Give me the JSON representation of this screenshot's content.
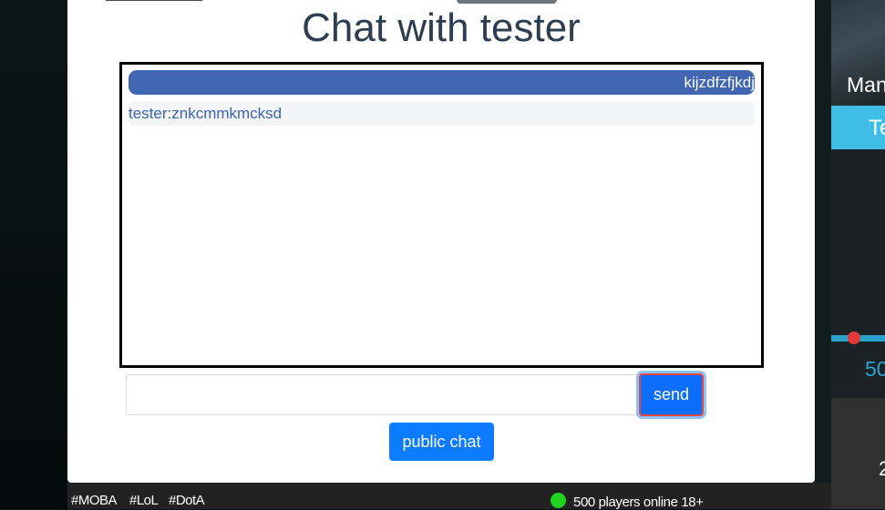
{
  "chat": {
    "title": "Chat with tester",
    "messages": [
      {
        "sender": "self",
        "text": "kijzdfzfjkdj"
      },
      {
        "sender": "other",
        "text": "tester:znkcmmkmcksd"
      }
    ],
    "input_value": "",
    "input_placeholder": "",
    "send_label": "send",
    "public_chat_label": "public chat"
  },
  "footer": {
    "tags": [
      "#MOBA",
      "#LoL",
      "#DotA"
    ],
    "players_online": "500 players online",
    "age_rating": "18+",
    "status_color": "#1fd31f"
  },
  "right_panel": {
    "name_partial": "Man",
    "tab_partial": "Te",
    "value_partial": "50",
    "card_partial": "2"
  },
  "colors": {
    "accent_blue": "#0d6efd",
    "own_message_bg": "#4267b2",
    "title_color": "#2c3e50",
    "right_tab": "#3fbde6"
  }
}
